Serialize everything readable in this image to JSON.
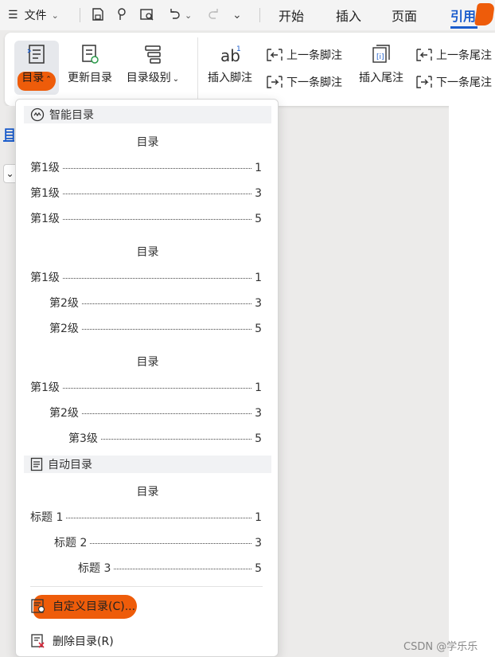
{
  "topbar": {
    "menu_label": "文件",
    "tabs": [
      {
        "label": "开始",
        "active": false
      },
      {
        "label": "插入",
        "active": false
      },
      {
        "label": "页面",
        "active": false
      },
      {
        "label": "引用",
        "active": true
      }
    ]
  },
  "ribbon": {
    "toc_label": "目录",
    "update_toc_label": "更新目录",
    "toc_level_label": "目录级别",
    "insert_footnote_label": "插入脚注",
    "prev_footnote_label": "上一条脚注",
    "next_footnote_label": "下一条脚注",
    "insert_endnote_label": "插入尾注",
    "prev_endnote_label": "上一条尾注",
    "next_endnote_label": "下一条尾注"
  },
  "sidebar": {
    "partial_label": "目"
  },
  "dropdown": {
    "smart_section_label": "智能目录",
    "smart_tocs": [
      {
        "title": "目录",
        "entries": [
          {
            "label": "第1级",
            "page": "1",
            "level": 1
          },
          {
            "label": "第1级",
            "page": "3",
            "level": 1
          },
          {
            "label": "第1级",
            "page": "5",
            "level": 1
          }
        ]
      },
      {
        "title": "目录",
        "entries": [
          {
            "label": "第1级",
            "page": "1",
            "level": 1
          },
          {
            "label": "第2级",
            "page": "3",
            "level": 2
          },
          {
            "label": "第2级",
            "page": "5",
            "level": 2
          }
        ]
      },
      {
        "title": "目录",
        "entries": [
          {
            "label": "第1级",
            "page": "1",
            "level": 1
          },
          {
            "label": "第2级",
            "page": "3",
            "level": 2
          },
          {
            "label": "第3级",
            "page": "5",
            "level": 3
          }
        ]
      }
    ],
    "auto_section_label": "自动目录",
    "auto_toc": {
      "title": "目录",
      "entries": [
        {
          "label": "标题 1",
          "page": "1",
          "level": 1
        },
        {
          "label": "标题 2",
          "page": "3",
          "level": 2
        },
        {
          "label": "标题 3",
          "page": "5",
          "level": 3
        }
      ]
    },
    "custom_toc_label": "自定义目录(C)...",
    "delete_toc_label": "删除目录(R)"
  },
  "watermark": "CSDN @学乐乐",
  "colors": {
    "accent": "#1a5ccc",
    "highlight": "#ee5c0a"
  }
}
